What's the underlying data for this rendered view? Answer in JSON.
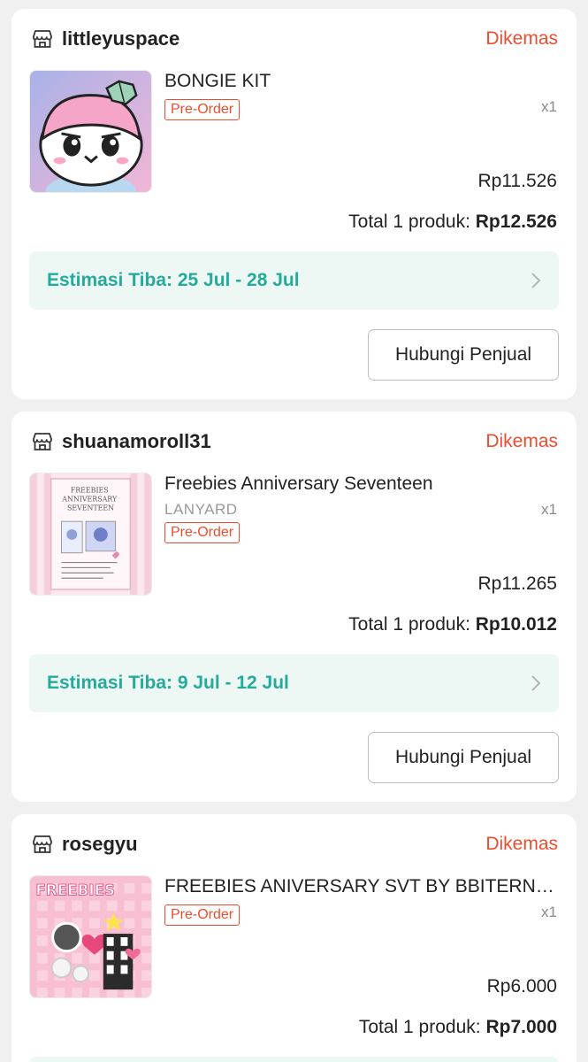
{
  "orders": [
    {
      "shop": "littleyuspace",
      "status": "Dikemas",
      "product_title": "BONGIE KIT",
      "variant": "",
      "badge": "Pre-Order",
      "qty": "x1",
      "price": "Rp11.526",
      "total_label": "Total 1 produk:",
      "total_value": "Rp12.526",
      "estimate": "Estimasi Tiba: 25 Jul - 28 Jul",
      "contact_button": "Hubungi Penjual"
    },
    {
      "shop": "shuanamoroll31",
      "status": "Dikemas",
      "product_title": "Freebies Anniversary Seventeen",
      "variant": "LANYARD",
      "badge": "Pre-Order",
      "qty": "x1",
      "price": "Rp11.265",
      "total_label": "Total 1 produk:",
      "total_value": "Rp10.012",
      "estimate": "Estimasi Tiba: 9 Jul - 12 Jul",
      "contact_button": "Hubungi Penjual"
    },
    {
      "shop": "rosegyu",
      "status": "Dikemas",
      "product_title": "FREEBIES ANIVERSARY SVT BY BBITERNITY",
      "variant": "",
      "badge": "Pre-Order",
      "qty": "x1",
      "price": "Rp6.000",
      "total_label": "Total 1 produk:",
      "total_value": "Rp7.000"
    }
  ],
  "thumbnail_text": {
    "freebies_anniversary_seventeen": "FREEBIES ANNIVERSARY SEVENTEEN",
    "freebies_banner": "FREEBIES"
  },
  "icons": {
    "shop": "shop-icon",
    "chevron": "chevron-right-icon"
  },
  "colors": {
    "status": "#ee4d2d",
    "estimate_text": "#26aa99",
    "estimate_bg": "#edf8f5",
    "page_bg": "#f0f0f0"
  }
}
